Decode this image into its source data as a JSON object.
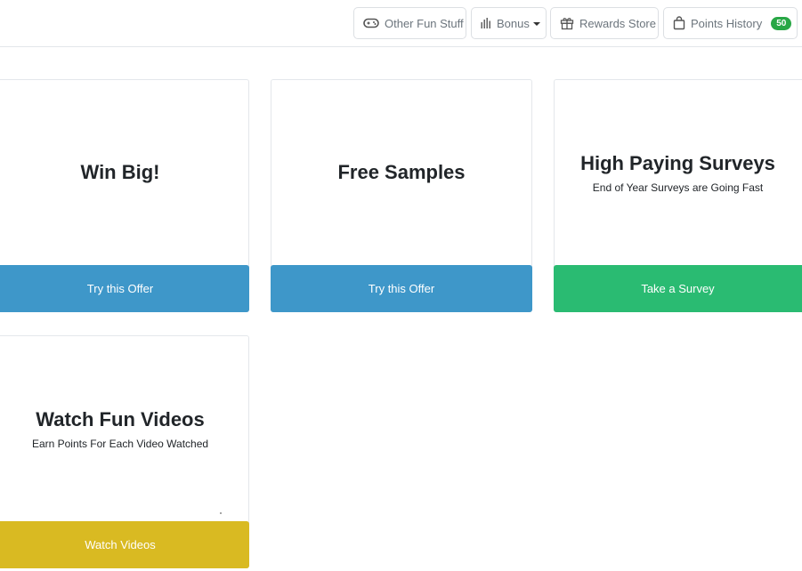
{
  "nav": {
    "other_fun": {
      "label": "Other Fun Stuff",
      "icon": "gamepad-icon"
    },
    "bonus": {
      "label": "Bonus",
      "icon": "bar-chart-icon"
    },
    "rewards": {
      "label": "Rewards Store",
      "icon": "gift-icon"
    },
    "points": {
      "label": "Points History",
      "icon": "shopping-bag-icon",
      "badge": "50"
    }
  },
  "cards": {
    "win_big": {
      "title": "Win Big!",
      "button": "Try this Offer"
    },
    "free_samples": {
      "title": "Free Samples",
      "button": "Try this Offer"
    },
    "surveys": {
      "title": "High Paying Surveys",
      "subtitle": "End of Year Surveys are Going Fast",
      "button": "Take a Survey"
    },
    "videos": {
      "title": "Watch Fun Videos",
      "subtitle": "Earn Points For Each Video Watched",
      "button": "Watch Videos"
    }
  },
  "colors": {
    "offer_button": "#3e97c9",
    "survey_button": "#2abb72",
    "video_button": "#d9ba22",
    "badge": "#28a745"
  }
}
